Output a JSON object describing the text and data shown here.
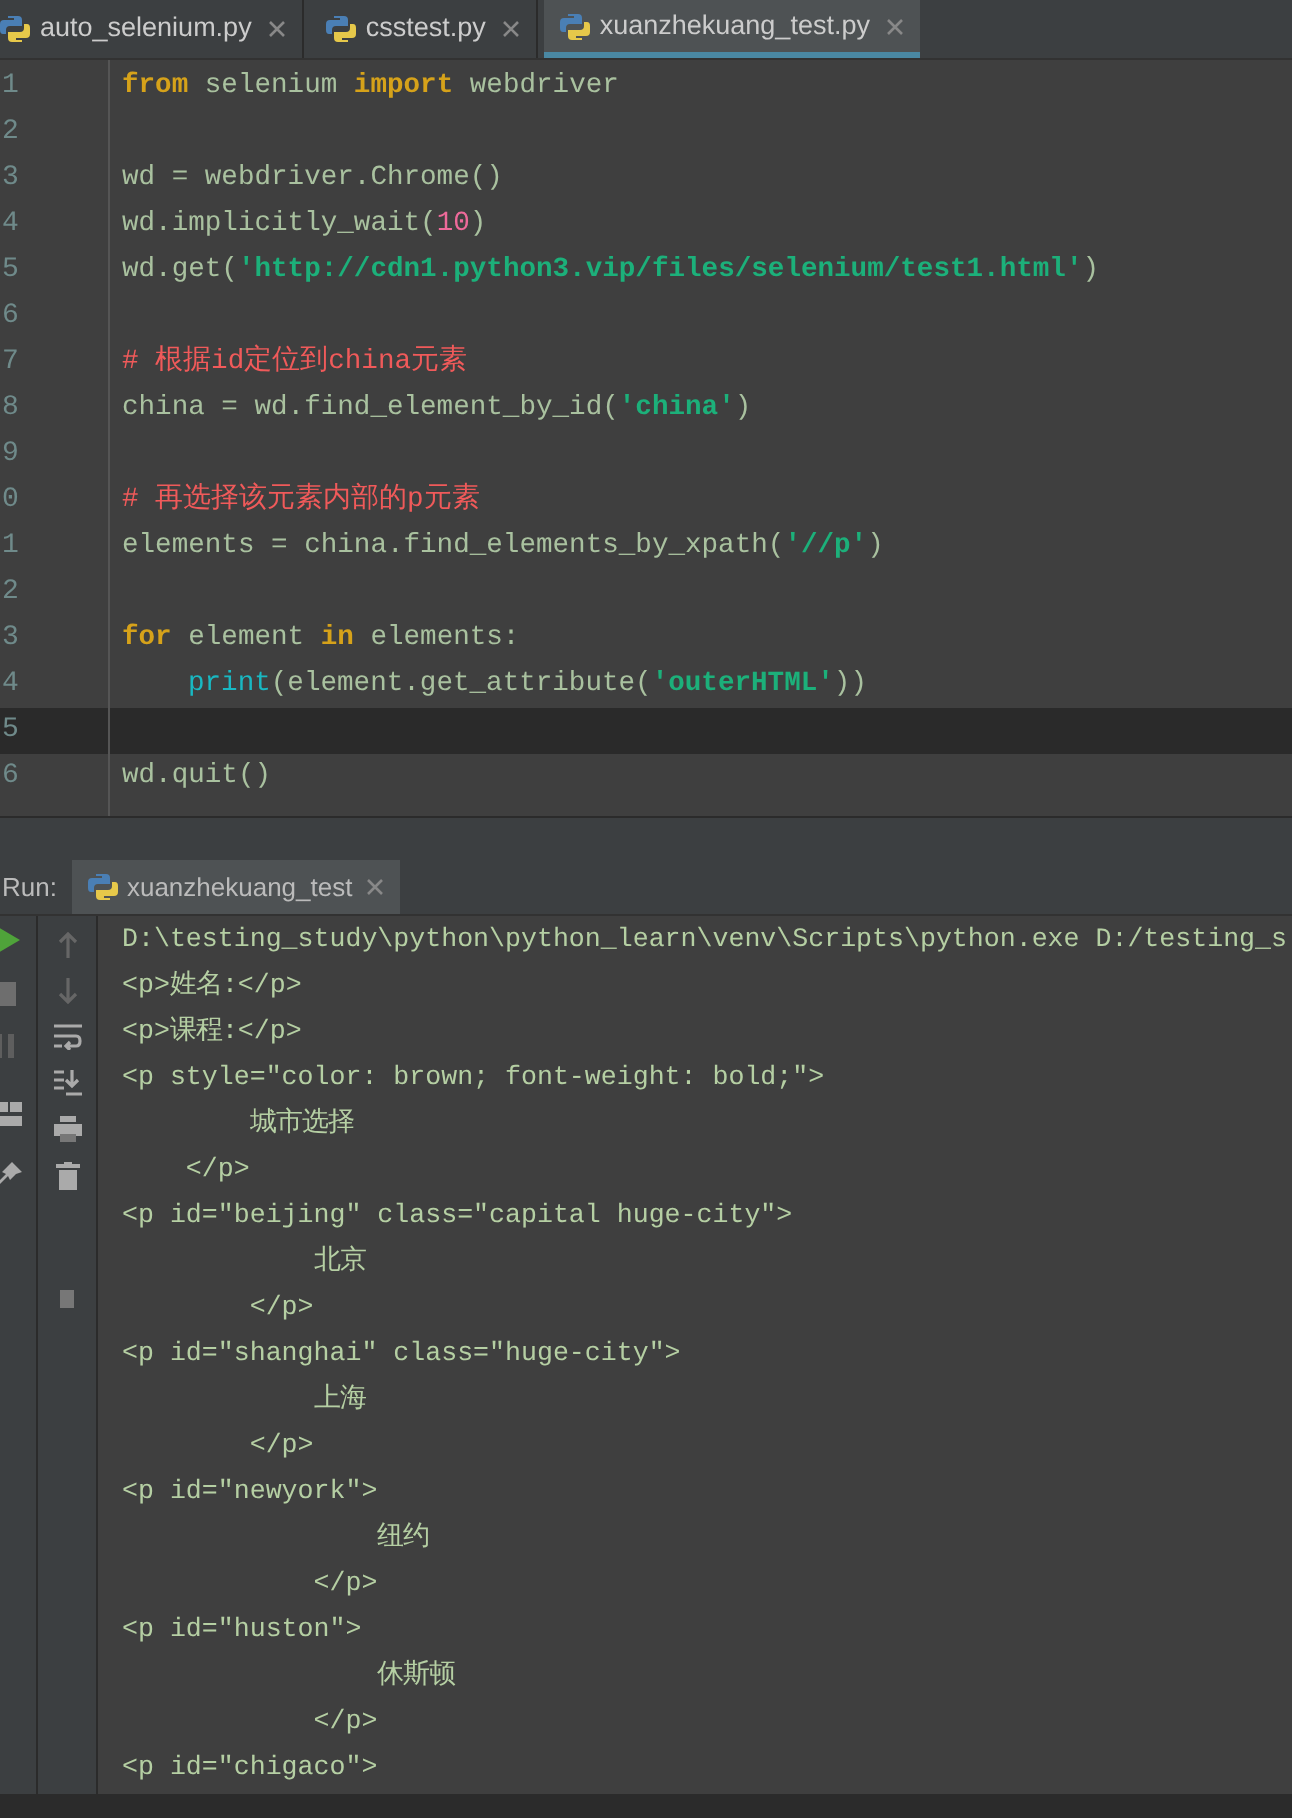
{
  "editor": {
    "tabs": [
      {
        "label": "auto_selenium.py",
        "selected": false
      },
      {
        "label": "csstest.py",
        "selected": false
      },
      {
        "label": "xuanzhekuang_test.py",
        "selected": true
      }
    ],
    "lines": [
      {
        "number": "1",
        "current": false,
        "tokens": [
          {
            "kind": "keyword",
            "text": "from"
          },
          {
            "kind": "plain",
            "text": " selenium "
          },
          {
            "kind": "keyword",
            "text": "import"
          },
          {
            "kind": "plain",
            "text": " webdriver"
          }
        ]
      },
      {
        "number": "2",
        "current": false
      },
      {
        "number": "3",
        "current": false,
        "tokens": [
          {
            "kind": "plain",
            "text": "wd = webdriver.Chrome()"
          }
        ]
      },
      {
        "number": "4",
        "current": false,
        "tokens": [
          {
            "kind": "plain",
            "text": "wd.implicitly_wait("
          },
          {
            "kind": "number",
            "text": "10"
          },
          {
            "kind": "plain",
            "text": ")"
          }
        ]
      },
      {
        "number": "5",
        "current": false,
        "tokens": [
          {
            "kind": "plain",
            "text": "wd.get("
          },
          {
            "kind": "string",
            "text": "'http://cdn1.python3.vip/files/selenium/test1.html'"
          },
          {
            "kind": "plain",
            "text": ")"
          }
        ]
      },
      {
        "number": "6",
        "current": false
      },
      {
        "number": "7",
        "current": false,
        "tokens": [
          {
            "kind": "comment",
            "text": "# 根据id定位到china元素"
          }
        ]
      },
      {
        "number": "8",
        "current": false,
        "tokens": [
          {
            "kind": "plain",
            "text": "china = wd.find_element_by_id("
          },
          {
            "kind": "string",
            "text": "'china'"
          },
          {
            "kind": "plain",
            "text": ")"
          }
        ]
      },
      {
        "number": "9",
        "current": false
      },
      {
        "number": "0",
        "current": false,
        "tokens": [
          {
            "kind": "comment",
            "text": "# 再选择该元素内部的p元素"
          }
        ]
      },
      {
        "number": "1",
        "current": false,
        "tokens": [
          {
            "kind": "plain",
            "text": "elements = china.find_elements_by_xpath("
          },
          {
            "kind": "string",
            "text": "'//p'"
          },
          {
            "kind": "plain",
            "text": ")"
          }
        ]
      },
      {
        "number": "2",
        "current": false
      },
      {
        "number": "3",
        "current": false,
        "tokens": [
          {
            "kind": "keyword",
            "text": "for"
          },
          {
            "kind": "plain",
            "text": " element "
          },
          {
            "kind": "keyword",
            "text": "in"
          },
          {
            "kind": "plain",
            "text": " elements:"
          }
        ]
      },
      {
        "number": "4",
        "current": false,
        "indented": true,
        "tokens": [
          {
            "kind": "builtin",
            "text": "print"
          },
          {
            "kind": "plain",
            "text": "(element.get_attribute("
          },
          {
            "kind": "string",
            "text": "'outerHTML'"
          },
          {
            "kind": "plain",
            "text": "))"
          }
        ]
      },
      {
        "number": "5",
        "current": true
      },
      {
        "number": "6",
        "current": false,
        "tokens": [
          {
            "kind": "plain",
            "text": "wd.quit()"
          }
        ]
      }
    ]
  },
  "run_panel": {
    "label": "Run:",
    "tab": {
      "label": "xuanzhekuang_test"
    },
    "output": [
      "D:\\testing_study\\python\\python_learn\\venv\\Scripts\\python.exe D:/testing_s",
      "<p>姓名:</p>",
      "<p>课程:</p>",
      "<p style=\"color: brown; font-weight: bold;\">",
      "        城市选择",
      "    </p>",
      "<p id=\"beijing\" class=\"capital huge-city\">",
      "            北京",
      "        </p>",
      "<p id=\"shanghai\" class=\"huge-city\">",
      "            上海",
      "        </p>",
      "<p id=\"newyork\">",
      "                纽约",
      "            </p>",
      "<p id=\"huston\">",
      "                休斯顿",
      "            </p>",
      "<p id=\"chigaco\">"
    ]
  }
}
